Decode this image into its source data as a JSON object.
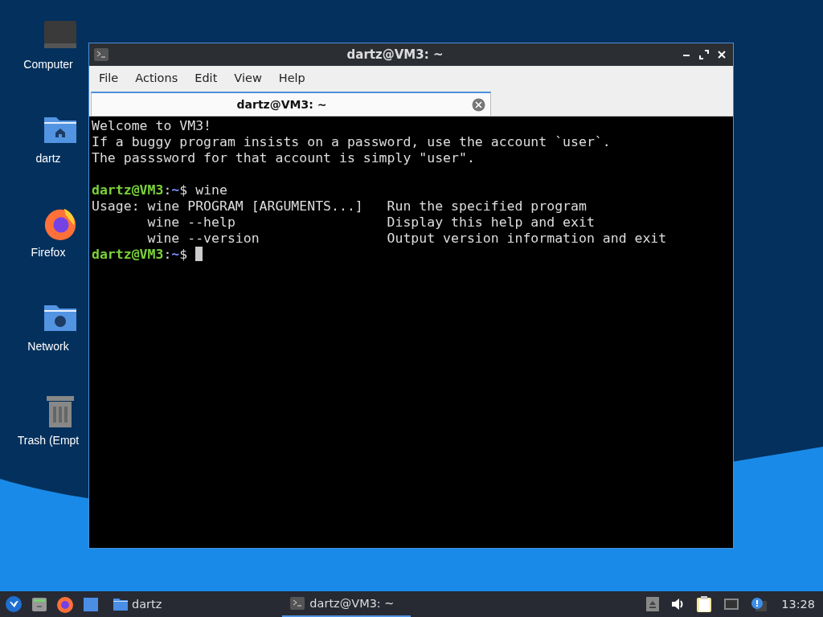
{
  "desktop_icons": [
    {
      "kind": "computer",
      "label": "Computer"
    },
    {
      "kind": "home-folder",
      "label": "dartz"
    },
    {
      "kind": "browser",
      "label": "Firefox"
    },
    {
      "kind": "network-folder",
      "label": "Network"
    },
    {
      "kind": "trash",
      "label": "Trash (Empt"
    }
  ],
  "window": {
    "title": "dartz@VM3: ~"
  },
  "menu": [
    "File",
    "Actions",
    "Edit",
    "View",
    "Help"
  ],
  "tabs": [
    {
      "label": "dartz@VM3: ~",
      "selected": true
    }
  ],
  "terminal": [
    {
      "kind": "output",
      "text": "Welcome to VM3!"
    },
    {
      "kind": "output",
      "text": "If a buggy program insists on a password, use the account `user`."
    },
    {
      "kind": "output",
      "text": "The passsword for that account is simply \"user\"."
    },
    {
      "kind": "blank"
    },
    {
      "kind": "prompt",
      "user_host": "dartz@VM3",
      "sep": ":",
      "path": "~",
      "symbol": "$",
      "command": "wine",
      "cursor": false
    },
    {
      "kind": "output",
      "text": "Usage: wine PROGRAM [ARGUMENTS...]   Run the specified program"
    },
    {
      "kind": "output",
      "text": "       wine --help                   Display this help and exit"
    },
    {
      "kind": "output",
      "text": "       wine --version                Output version information and exit"
    },
    {
      "kind": "prompt",
      "user_host": "dartz@VM3",
      "sep": ":",
      "path": "~",
      "symbol": "$",
      "cursor": true
    }
  ],
  "taskbar": {
    "launchers": [
      {
        "kind": "menu"
      },
      {
        "kind": "files"
      },
      {
        "kind": "browser"
      },
      {
        "kind": "desktop"
      }
    ],
    "folder": {
      "label": "dartz"
    },
    "task": {
      "label": "dartz@VM3: ~",
      "selected": true
    },
    "clock": "13:28"
  }
}
